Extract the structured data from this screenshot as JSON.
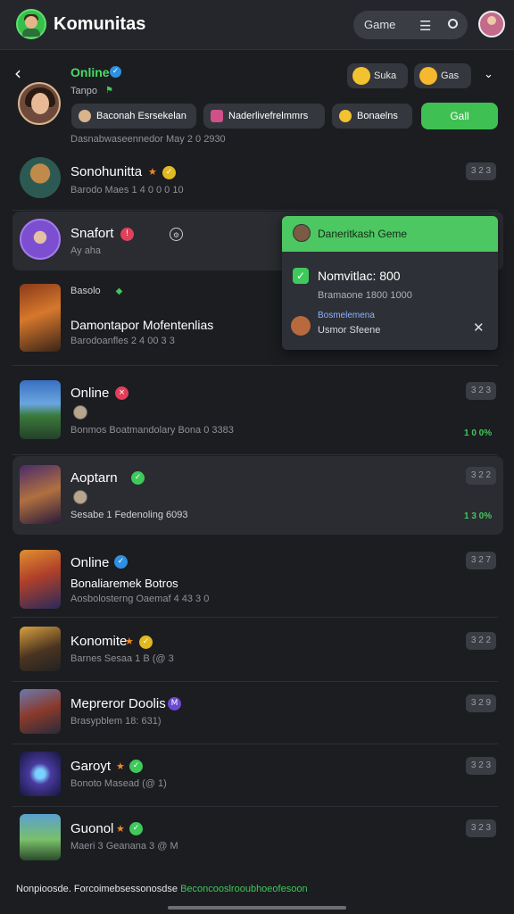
{
  "header": {
    "title": "Komunitas",
    "game_label": "Game"
  },
  "profile": {
    "status": "Online",
    "sub": "Tanpo",
    "sub_badge": "⚑",
    "emoji_chip_1": "Suka",
    "emoji_chip_2": "Gas",
    "tags": [
      "Baconah Esrsekelan",
      "Naderlivefrelmmrs",
      "Bonaelns"
    ],
    "call_label": "Gall",
    "meta": "Dasnabwaseennedor May 2 0 2930"
  },
  "rows": [
    {
      "title": "Sonohunitta",
      "sub": "Barodo Maes 1 4 0 0 0 10",
      "time": "3 2 3",
      "count": ""
    },
    {
      "title": "Snafort",
      "sub": "Ay aha",
      "time": "",
      "count": ""
    },
    {
      "title": "Basolo",
      "line2": "Damontapor Mofentenlias",
      "sub": "Barodoanfles 2 4 00 3 3",
      "time": "",
      "count": ""
    },
    {
      "title": "Online",
      "sub": "Bonmos Boatmandolary Bona 0 3383",
      "time": "3 2 3",
      "count": "1 0 0%"
    },
    {
      "title": "Aoptarn",
      "sub": "Sesabe 1 Fedenoling 6093",
      "time": "3 2 2",
      "count": "1 3 0%"
    },
    {
      "title": "Online",
      "line2": "Bonaliaremek Botros",
      "sub": "Aosbolosterng Oaemaf 4 43 3 0",
      "time": "3 2 7",
      "count": ""
    },
    {
      "title": "Konomite",
      "sub": "Barnes Sesaa 1 B (@ 3",
      "time": "3 2 2",
      "count": ""
    },
    {
      "title": "Mepreror Doolis",
      "sub": "Brasypblem 18: 631)",
      "time": "3 2 9",
      "count": ""
    },
    {
      "title": "Garoyt",
      "sub": "Bonoto Masead (@ 1)",
      "time": "3 2 3",
      "count": ""
    },
    {
      "title": "Guonol",
      "sub": "Maeri 3 Geanana 3 @ M",
      "time": "3 2 3",
      "count": ""
    }
  ],
  "popup": {
    "header": "Daneritkash Geme",
    "title": "Nomvitlac: 800",
    "sub": "Bramaone 1800 1000",
    "note_label": "Bosmelemena",
    "note_value": "Usmor Sfeene"
  },
  "footer": {
    "white": "Nonpioosde. Forcoimebsessonosdse",
    "green": "Beconcooslrooubhoeofesoon"
  },
  "colors": {
    "accent": "#3fc052",
    "background": "#1b1d21"
  }
}
